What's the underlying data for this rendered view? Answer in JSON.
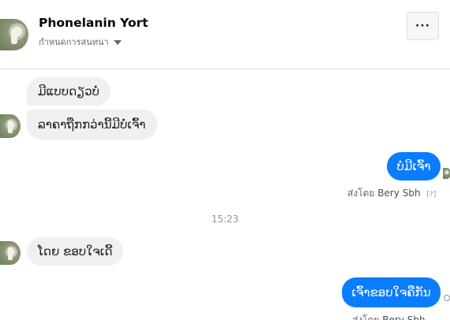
{
  "header": {
    "name": "Phonelanin Yort",
    "subtitle": "กำหนดการสนทนา",
    "more_label": "···"
  },
  "messages": {
    "m1": "ມີແບບດຽວບໍ່",
    "m2": "ລາຄາຖືກກວ່ານີ້ມີບໍ່ເຈົ້າ",
    "m3": "ບໍ່ມີເຈົ້າ",
    "sent_by_prefix": "ส่งโดย",
    "sent_by_name": "Bery Sbh",
    "sent_by_q": "[?]",
    "time": "15:23",
    "m4": "ໂດຍ ຂອບໃຈເດີ້",
    "m5": "ເຈົ້າຂອບໃຈຄືກັນ"
  },
  "icons": {
    "more": "more-dots-icon",
    "caret": "caret-down-icon"
  }
}
